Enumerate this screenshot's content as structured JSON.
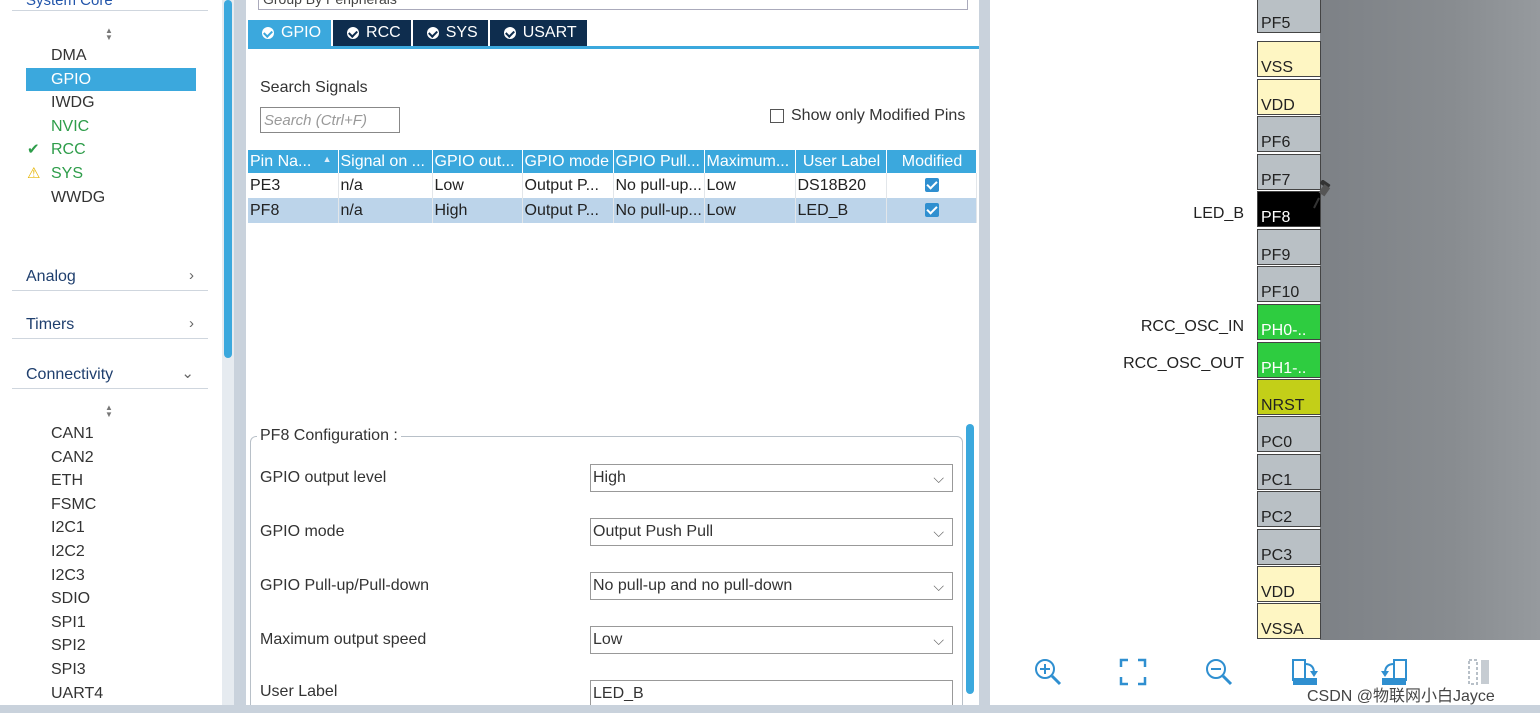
{
  "left_panel": {
    "top_cut_label": "System Core",
    "core_items": [
      {
        "label": "DMA",
        "mark": ""
      },
      {
        "label": "GPIO",
        "mark": ""
      },
      {
        "label": "IWDG",
        "mark": ""
      },
      {
        "label": "NVIC",
        "mark": ""
      },
      {
        "label": "RCC",
        "mark": "✔"
      },
      {
        "label": "SYS",
        "mark": "⚠"
      },
      {
        "label": "WWDG",
        "mark": ""
      }
    ],
    "categories": {
      "analog": "Analog",
      "timers": "Timers",
      "connectivity": "Connectivity",
      "chevron_right": "›",
      "chevron_down": "⌄"
    },
    "connectivity_items": [
      "CAN1",
      "CAN2",
      "ETH",
      "FSMC",
      "I2C1",
      "I2C2",
      "I2C3",
      "SDIO",
      "SPI1",
      "SPI2",
      "SPI3",
      "UART4"
    ]
  },
  "middle_panel": {
    "group_by_label": "Group By Peripherals",
    "tabs": [
      "GPIO",
      "RCC",
      "SYS",
      "USART"
    ],
    "search_label": "Search Signals",
    "search_placeholder": "Search (Ctrl+F)",
    "show_modified_label": "Show only Modified Pins",
    "table": {
      "headers": [
        "Pin Na...",
        "Signal on ...",
        "GPIO out...",
        "GPIO mode",
        "GPIO Pull...",
        "Maximum...",
        "User Label",
        "Modified"
      ],
      "rows": [
        {
          "pin": "PE3",
          "signal": "n/a",
          "output": "Low",
          "mode": "Output P...",
          "pull": "No pull-up...",
          "speed": "Low",
          "label": "DS18B20"
        },
        {
          "pin": "PF8",
          "signal": "n/a",
          "output": "High",
          "mode": "Output P...",
          "pull": "No pull-up...",
          "speed": "Low",
          "label": "LED_B"
        }
      ]
    },
    "config": {
      "title": "PF8 Configuration :",
      "rows": [
        {
          "label": "GPIO output level",
          "value": "High"
        },
        {
          "label": "GPIO mode",
          "value": "Output Push Pull"
        },
        {
          "label": "GPIO Pull-up/Pull-down",
          "value": "No pull-up and no pull-down"
        },
        {
          "label": "Maximum output speed",
          "value": "Low"
        },
        {
          "label": "User Label",
          "value": "LED_B"
        }
      ],
      "dropdown_glyph": "⌵"
    }
  },
  "right_panel": {
    "pins": [
      {
        "name": "PF5",
        "style": "gray"
      },
      {
        "name": "VSS",
        "style": "cream"
      },
      {
        "name": "VDD",
        "style": "cream"
      },
      {
        "name": "PF6",
        "style": "gray"
      },
      {
        "name": "PF7",
        "style": "gray"
      },
      {
        "name": "PF8",
        "style": "black"
      },
      {
        "name": "PF9",
        "style": "gray"
      },
      {
        "name": "PF10",
        "style": "gray"
      },
      {
        "name": "PH0-..",
        "style": "green"
      },
      {
        "name": "PH1-..",
        "style": "green"
      },
      {
        "name": "NRST",
        "style": "olive"
      },
      {
        "name": "PC0",
        "style": "gray"
      },
      {
        "name": "PC1",
        "style": "gray"
      },
      {
        "name": "PC2",
        "style": "gray"
      },
      {
        "name": "PC3",
        "style": "gray"
      },
      {
        "name": "VDD",
        "style": "cream"
      },
      {
        "name": "VSSA",
        "style": "cream"
      }
    ],
    "pin_labels": {
      "pf8": "LED_B",
      "ph0": "RCC_OSC_IN",
      "ph1": "RCC_OSC_OUT"
    },
    "toolbar_icons": [
      "zoom-in-icon",
      "fit-to-screen-icon",
      "zoom-out-icon",
      "rotate-right-icon",
      "rotate-left-icon",
      "split-view-icon"
    ],
    "watermark": "CSDN @物联网小白Jayce"
  },
  "colors": {
    "accent": "#3ba8dd",
    "tab_dark": "#0e2d4e",
    "pin_selected": "#000000",
    "pin_green": "#2ecc40",
    "pin_olive": "#c3cf18",
    "pin_cream": "#fef6c3",
    "pin_gray": "#b9c0c5"
  }
}
